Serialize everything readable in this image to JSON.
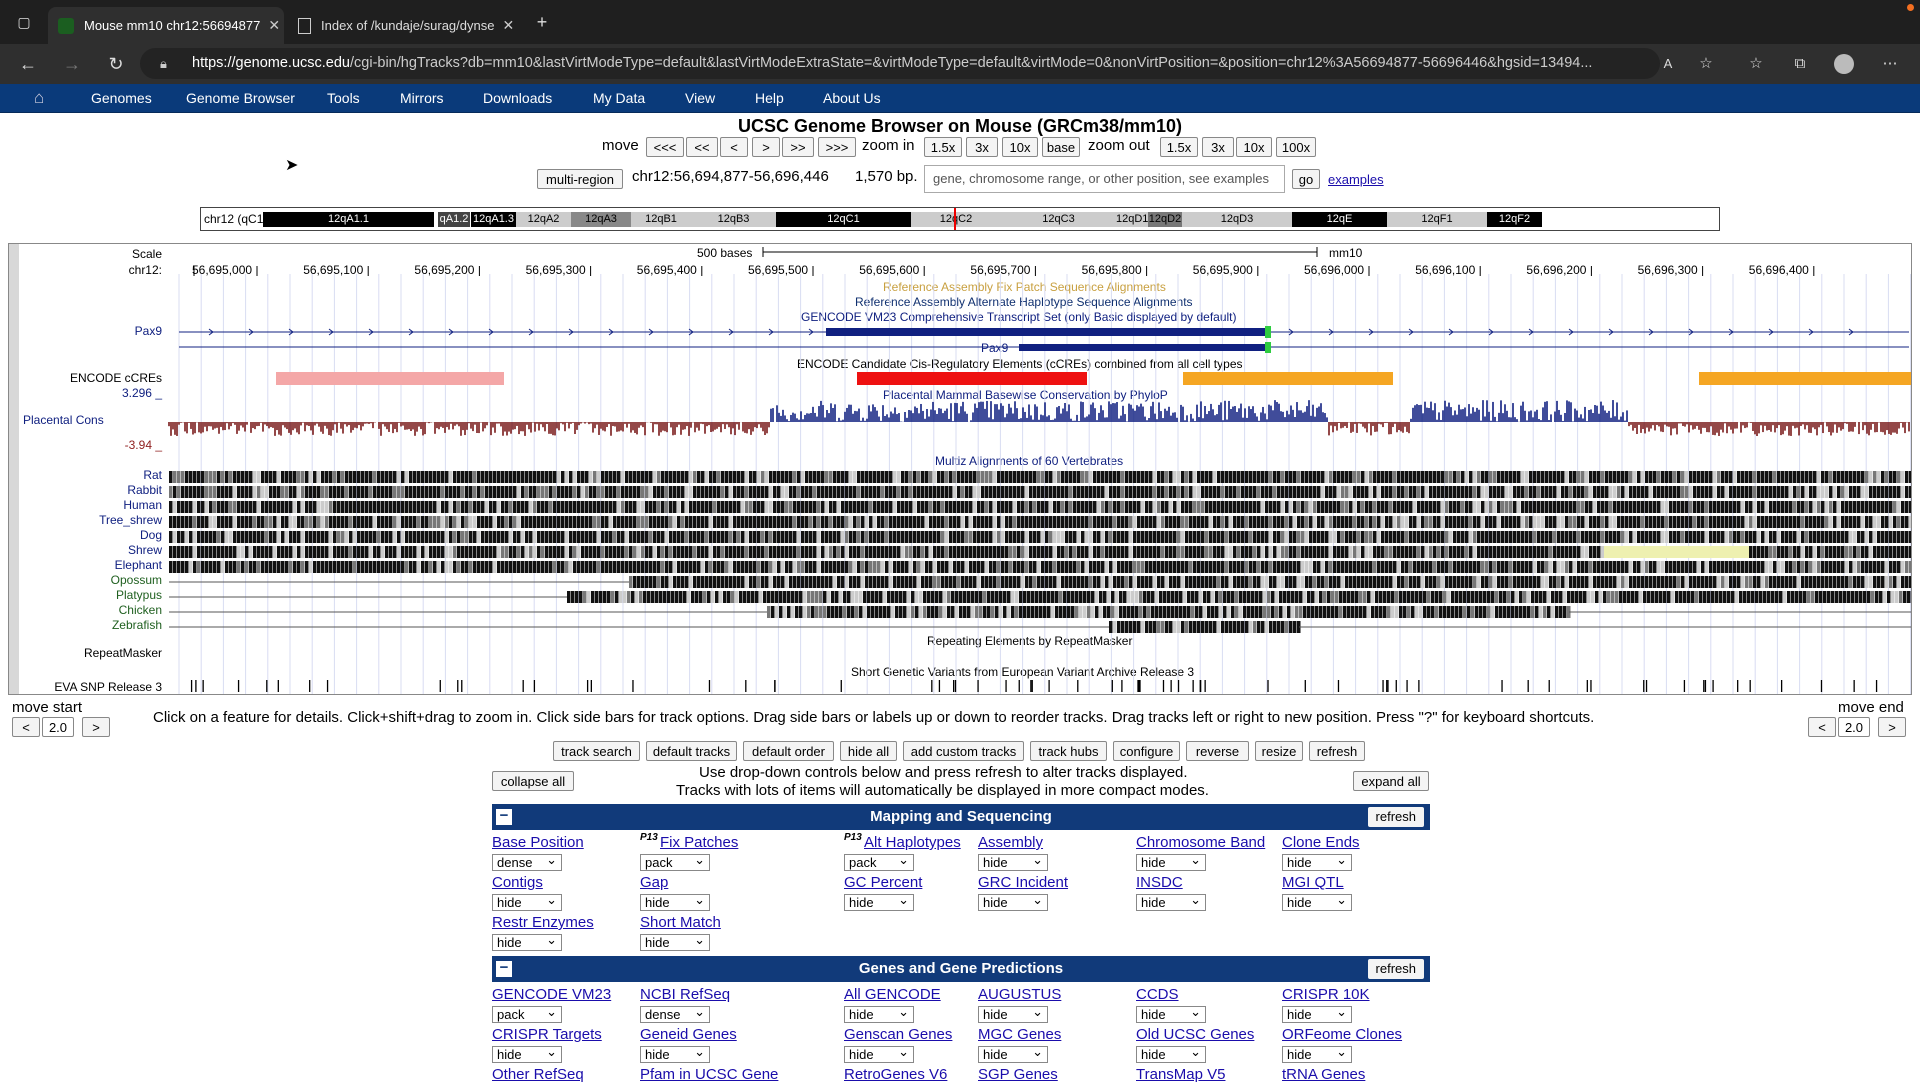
{
  "browser": {
    "tabs": [
      {
        "title": "Mouse mm10 chr12:56694877",
        "active": true
      },
      {
        "title": "Index of /kundaje/surag/dynse",
        "active": false
      }
    ],
    "url_host": "https://genome.ucsc.edu",
    "url_path": "/cgi-bin/hgTracks?db=mm10&lastVirtModeType=default&lastVirtModeExtraState=&virtModeType=default&virtMode=0&nonVirtPosition=&position=chr12%3A56694877-56696446&hgsid=13494..."
  },
  "nav": [
    "Genomes",
    "Genome Browser",
    "Tools",
    "Mirrors",
    "Downloads",
    "My Data",
    "View",
    "Help",
    "About Us"
  ],
  "title": "UCSC Genome Browser on Mouse (GRCm38/mm10)",
  "controls": {
    "move_label": "move",
    "move_buttons": [
      "<<<",
      "<<",
      "<",
      ">",
      ">>",
      ">>>"
    ],
    "zoom_in_label": "zoom in",
    "zoom_in_buttons": [
      "1.5x",
      "3x",
      "10x",
      "base"
    ],
    "zoom_out_label": "zoom out",
    "zoom_out_buttons": [
      "1.5x",
      "3x",
      "10x",
      "100x"
    ],
    "multi_region": "multi-region",
    "position": "chr12:56,694,877-56,696,446",
    "bp": "1,570 bp.",
    "search_placeholder": "gene, chromosome range, or other position, see examples",
    "go": "go",
    "examples": "examples"
  },
  "ideogram": {
    "chrom_label": "chr12 (qC1)",
    "bands": [
      "12qA1.1",
      "qA1.2",
      "12qA1.3",
      "12qA2",
      "12qA3",
      "12qB1",
      "12qB3",
      "12qC1",
      "12qC2",
      "12qC3",
      "12qD1",
      "12qD2",
      "12qD3",
      "12qE",
      "12qF1",
      "12qF2"
    ]
  },
  "tracks": {
    "scale_label": "Scale",
    "scale_bar": "500 bases",
    "assembly": "mm10",
    "chrom": "chr12:",
    "ticks": [
      "56,695,000",
      "56,695,100",
      "56,695,200",
      "56,695,300",
      "56,695,400",
      "56,695,500",
      "56,695,600",
      "56,695,700",
      "56,695,800",
      "56,695,900",
      "56,696,000",
      "56,696,100",
      "56,696,200",
      "56,696,300",
      "56,696,400"
    ],
    "fix_patch": "Reference Assembly Fix Patch Sequence Alignments",
    "alt_hap": "Reference Assembly Alternate Haplotype Sequence Alignments",
    "gencode": "GENCODE VM23 Comprehensive Transcript Set (only Basic displayed by default)",
    "gene1": "Pax9",
    "gene2": "Pax9",
    "encode": "ENCODE Candidate Cis-Regulatory Elements (cCREs) combined from all cell types",
    "encode_label": "ENCODE cCREs",
    "phylop": "Placental Mammal Basewise Conservation by PhyloP",
    "cons_label": "Placental Cons",
    "cons_max": "3.296 _",
    "cons_min": "-3.94 _",
    "multiz": "Multiz Alignments of 60 Vertebrates",
    "species": [
      "Rat",
      "Rabbit",
      "Human",
      "Tree_shrew",
      "Dog",
      "Shrew",
      "Elephant",
      "Opossum",
      "Platypus",
      "Chicken",
      "Zebrafish"
    ],
    "repeat_label": "RepeatMasker",
    "repeat": "Repeating Elements by RepeatMasker",
    "eva_label": "EVA SNP Release 3",
    "eva": "Short Genetic Variants from European Variant Archive Release 3"
  },
  "below": {
    "move_start": "move start",
    "move_end": "move end",
    "step": "2.0",
    "help": "Click on a feature for details. Click+shift+drag to zoom in. Click side bars for track options. Drag side bars or labels up or down to reorder tracks. Drag tracks left or right to new position. Press \"?\" for keyboard shortcuts.",
    "buttons": [
      "track search",
      "default tracks",
      "default order",
      "hide all",
      "add custom tracks",
      "track hubs",
      "configure",
      "reverse",
      "resize",
      "refresh"
    ],
    "collapse": "collapse all",
    "expand": "expand all",
    "note1": "Use drop-down controls below and press refresh to alter tracks displayed.",
    "note2": "Tracks with lots of items will automatically be displayed in more compact modes."
  },
  "groups": [
    {
      "title": "Mapping and Sequencing",
      "refresh": "refresh"
    },
    {
      "title": "Genes and Gene Predictions",
      "refresh": "refresh"
    }
  ],
  "mapping_tracks": [
    {
      "name": "Base Position",
      "mode": "dense"
    },
    {
      "name": "Fix Patches",
      "mode": "pack",
      "prefix": "P13"
    },
    {
      "name": "Alt Haplotypes",
      "mode": "pack",
      "prefix": "P13"
    },
    {
      "name": "Assembly",
      "mode": "hide"
    },
    {
      "name": "Chromosome Band",
      "mode": "hide"
    },
    {
      "name": "Clone Ends",
      "mode": "hide"
    },
    {
      "name": "Contigs",
      "mode": "hide"
    },
    {
      "name": "Gap",
      "mode": "hide"
    },
    {
      "name": "GC Percent",
      "mode": "hide"
    },
    {
      "name": "GRC Incident",
      "mode": "hide"
    },
    {
      "name": "INSDC",
      "mode": "hide"
    },
    {
      "name": "MGI QTL",
      "mode": "hide"
    },
    {
      "name": "Restr Enzymes",
      "mode": "hide"
    },
    {
      "name": "Short Match",
      "mode": "hide"
    }
  ],
  "gene_tracks": [
    {
      "name": "GENCODE VM23",
      "mode": "pack"
    },
    {
      "name": "NCBI RefSeq",
      "mode": "dense"
    },
    {
      "name": "All GENCODE",
      "mode": "hide"
    },
    {
      "name": "AUGUSTUS",
      "mode": "hide"
    },
    {
      "name": "CCDS",
      "mode": "hide"
    },
    {
      "name": "CRISPR 10K",
      "mode": "hide"
    },
    {
      "name": "CRISPR Targets",
      "mode": "hide"
    },
    {
      "name": "Geneid Genes",
      "mode": "hide"
    },
    {
      "name": "Genscan Genes",
      "mode": "hide"
    },
    {
      "name": "MGC Genes",
      "mode": "hide"
    },
    {
      "name": "Old UCSC Genes",
      "mode": "hide"
    },
    {
      "name": "ORFeome Clones",
      "mode": "hide"
    },
    {
      "name": "Other RefSeq",
      "mode": ""
    },
    {
      "name": "Pfam in UCSC Gene",
      "mode": ""
    },
    {
      "name": "RetroGenes V6",
      "mode": ""
    },
    {
      "name": "SGP Genes",
      "mode": ""
    },
    {
      "name": "TransMap V5",
      "mode": ""
    },
    {
      "name": "tRNA Genes",
      "mode": ""
    }
  ]
}
